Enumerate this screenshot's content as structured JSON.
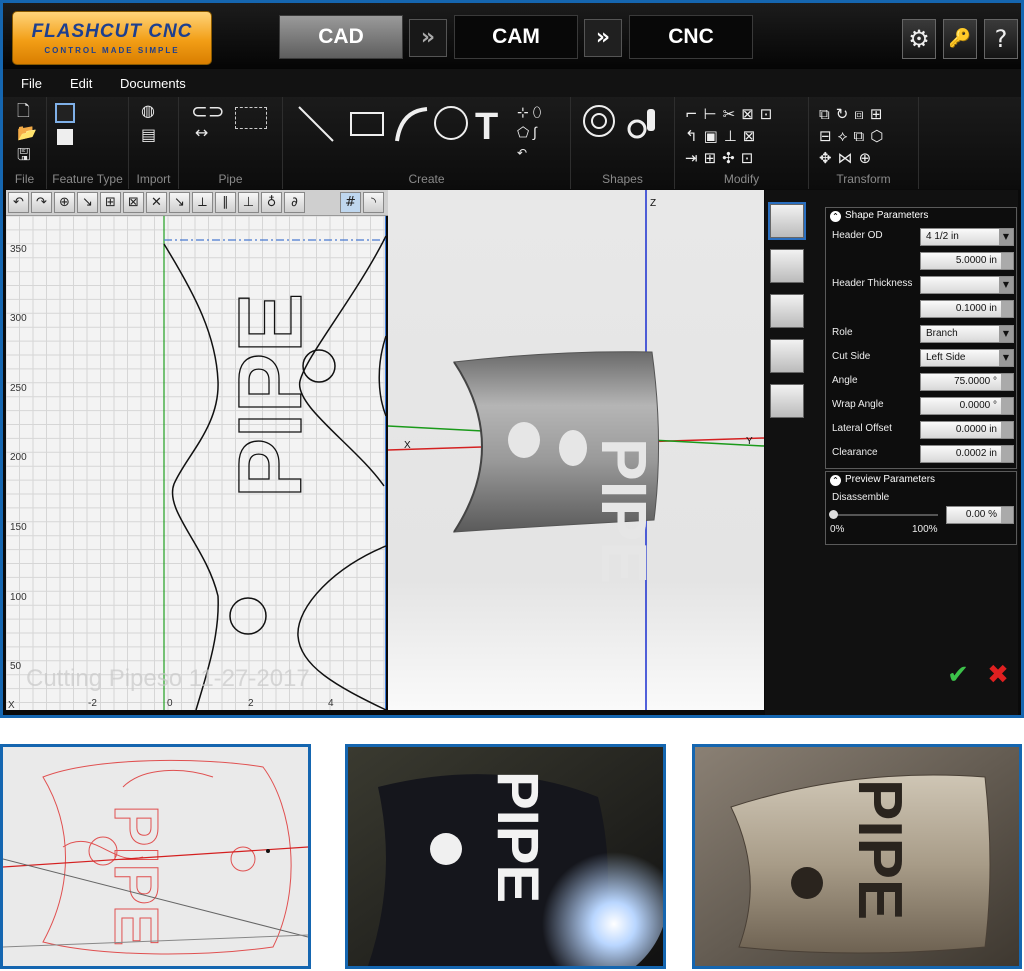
{
  "app": {
    "logo_title": "FLASHCUT CNC",
    "logo_tagline": "CONTROL MADE SIMPLE",
    "modes": [
      {
        "label": "CAD",
        "active": true
      },
      {
        "label": "CAM",
        "active": false
      },
      {
        "label": "CNC",
        "active": false
      }
    ],
    "arrow_glyph": "»",
    "settings_glyph": "⚙",
    "key_glyph": "🔑",
    "help_glyph": "?"
  },
  "menu": [
    "File",
    "Edit",
    "Documents"
  ],
  "ribbon_groups": [
    "File",
    "Feature Type",
    "Import",
    "Pipe",
    "Create",
    "Shapes",
    "Modify",
    "Transform"
  ],
  "view2d": {
    "y_ticks": [
      "350",
      "300",
      "250",
      "200",
      "150",
      "100",
      "50"
    ],
    "x_ticks": [
      "-2",
      "0",
      "2",
      "4"
    ],
    "axis_label": "X",
    "lettering": "PIPE",
    "watermark": "Cutting Pipeso 11-27-2017"
  },
  "view3d": {
    "axis_x": "X",
    "axis_y": "Y",
    "axis_z": "Z",
    "lettering": "PIPE"
  },
  "shape_parameters": {
    "title": "Shape Parameters",
    "header_od_label": "Header OD",
    "header_od_value": "4 1/2 in",
    "header_od_size": "5.0000 in",
    "header_thickness_label": "Header Thickness",
    "header_thickness_select": "",
    "header_thickness_value": "0.1000 in",
    "role_label": "Role",
    "role_value": "Branch",
    "cut_side_label": "Cut Side",
    "cut_side_value": "Left Side",
    "angle_label": "Angle",
    "angle_value": "75.0000 °",
    "wrap_angle_label": "Wrap Angle",
    "wrap_angle_value": "0.0000 °",
    "lateral_offset_label": "Lateral Offset",
    "lateral_offset_value": "0.0000 in",
    "clearance_label": "Clearance",
    "clearance_value": "0.0002 in"
  },
  "preview_parameters": {
    "title": "Preview Parameters",
    "disassemble_label": "Disassemble",
    "slider_fraction": 0.0,
    "min_label": "0%",
    "max_label": "100%",
    "value": "0.00 %"
  },
  "actions": {
    "ok_glyph": "✔",
    "cancel_glyph": "✖"
  },
  "photos": {
    "toolpath_lettering": "PIPE",
    "cut_lettering": "PIPE",
    "finished_lettering": "PIPE"
  },
  "colors": {
    "accent_blue": "#1566b0",
    "axis_x": "#d42020",
    "axis_y": "#1a9a1a",
    "axis_z": "#1a2fd0",
    "toolpath": "#e05050",
    "ok": "#3cc24a",
    "cancel": "#e02020"
  }
}
